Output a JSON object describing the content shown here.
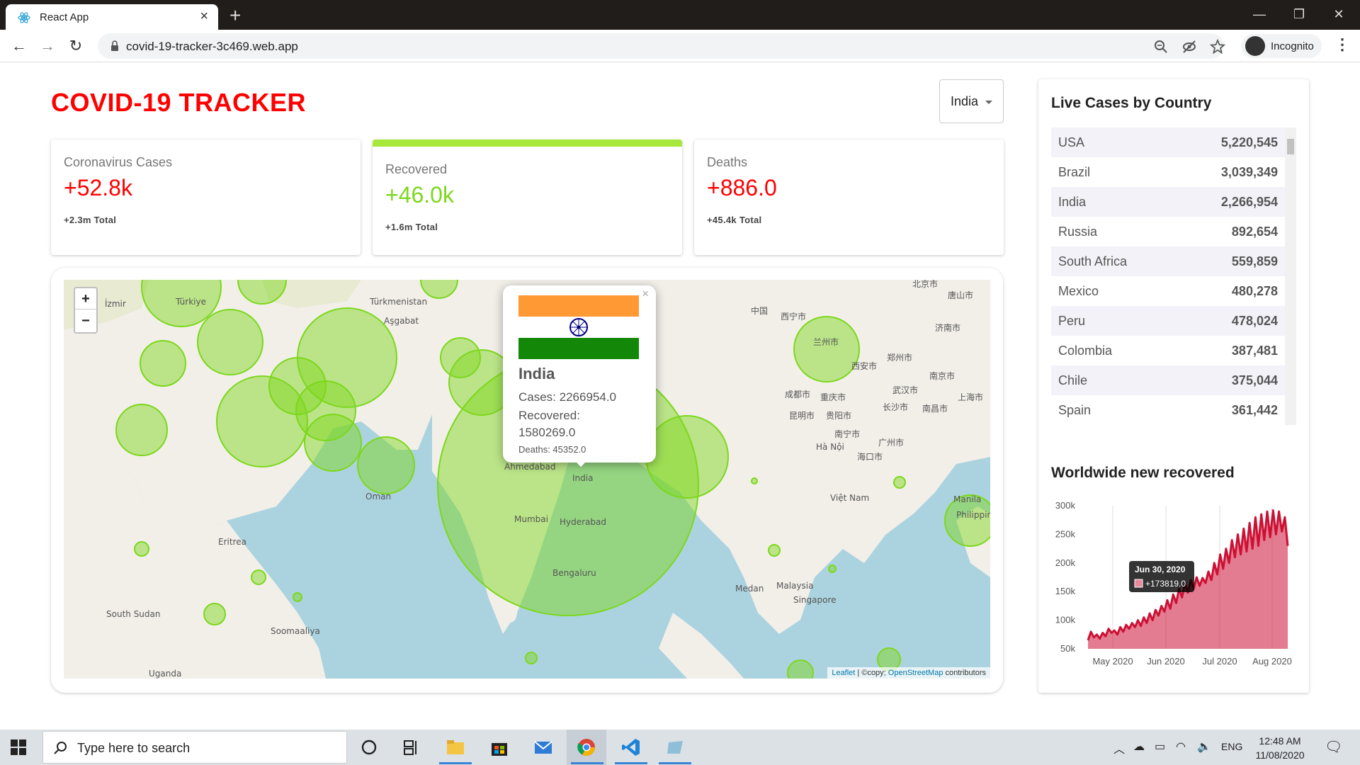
{
  "browser": {
    "tab_title": "React App",
    "url": "covid-19-tracker-3c469.web.app",
    "incognito_label": "Incognito"
  },
  "app": {
    "title": "COVID-19 TRACKER",
    "country_selected": "India"
  },
  "cards": {
    "cases": {
      "title": "Coronavirus Cases",
      "value": "+52.8k",
      "total": "+2.3m Total",
      "color": "#ff0000"
    },
    "recovered": {
      "title": "Recovered",
      "value": "+46.0k",
      "total": "+1.6m Total",
      "color": "#7dd71d"
    },
    "deaths": {
      "title": "Deaths",
      "value": "+886.0",
      "total": "+45.4k Total",
      "color": "#ff0000"
    }
  },
  "map": {
    "attribution_leaflet": "Leaflet",
    "attribution_copy": "| ©copy;",
    "attribution_osm": "OpenStreetMap",
    "attribution_contrib": "contributors",
    "popup": {
      "country": "India",
      "cases": "Cases: 2266954.0",
      "recovered_label": "Recovered:",
      "recovered_value": "1580269.0",
      "deaths": "Deaths: 45352.0"
    },
    "labels": [
      "Türkiye",
      "Türkmenistan",
      "Aşgabat",
      "India",
      "Ahmedabad",
      "Mumbai",
      "Hyderabad",
      "Bengaluru",
      "Eritrea",
      "South Sudan",
      "Soomaaliya",
      "Uganda",
      "中国",
      "西宁市",
      "兰州市",
      "西安市",
      "郑州市",
      "北京市",
      "唐山市",
      "济南市",
      "南京市",
      "上海市",
      "武汉市",
      "长沙市",
      "南昌市",
      "成都市",
      "重庆市",
      "贵阳市",
      "昆明市",
      "南宁市",
      "广州市",
      "海口市",
      "Hà Nội",
      "Việt Nam",
      "Manila",
      "Philippines",
      "Medan",
      "Malaysia",
      "Singapore",
      "İzmir",
      "Oman"
    ]
  },
  "live": {
    "heading": "Live Cases by Country",
    "rows": [
      {
        "country": "USA",
        "cases": "5,220,545"
      },
      {
        "country": "Brazil",
        "cases": "3,039,349"
      },
      {
        "country": "India",
        "cases": "2,266,954"
      },
      {
        "country": "Russia",
        "cases": "892,654"
      },
      {
        "country": "South Africa",
        "cases": "559,859"
      },
      {
        "country": "Mexico",
        "cases": "480,278"
      },
      {
        "country": "Peru",
        "cases": "478,024"
      },
      {
        "country": "Colombia",
        "cases": "387,481"
      },
      {
        "country": "Chile",
        "cases": "375,044"
      },
      {
        "country": "Spain",
        "cases": "361,442"
      }
    ]
  },
  "chart_heading": "Worldwide new recovered",
  "chart_data": {
    "type": "area",
    "x_tick_labels": [
      "May 2020",
      "Jun 2020",
      "Jul 2020",
      "Aug 2020"
    ],
    "y_tick_labels": [
      "300k",
      "250k",
      "200k",
      "150k",
      "100k",
      "50k"
    ],
    "ylim": [
      50000,
      300000
    ],
    "color": "#cc1034",
    "fill": "rgba(204,16,52,0.55)",
    "tooltip": {
      "date": "Jun 30, 2020",
      "value": "+173819.0"
    },
    "values": [
      65000,
      80000,
      70000,
      75000,
      68000,
      78000,
      72000,
      85000,
      78000,
      82000,
      75000,
      88000,
      80000,
      92000,
      85000,
      95000,
      88000,
      100000,
      90000,
      105000,
      95000,
      112000,
      100000,
      118000,
      108000,
      125000,
      115000,
      135000,
      120000,
      145000,
      130000,
      155000,
      140000,
      165000,
      148000,
      170000,
      155000,
      175000,
      160000,
      173819,
      165000,
      185000,
      170000,
      200000,
      180000,
      215000,
      190000,
      225000,
      200000,
      240000,
      210000,
      250000,
      215000,
      260000,
      220000,
      270000,
      225000,
      280000,
      230000,
      285000,
      240000,
      290000,
      245000,
      292000,
      250000,
      290000,
      255000,
      280000,
      230000
    ]
  },
  "taskbar": {
    "search_placeholder": "Type here to search",
    "lang": "ENG",
    "time": "12:48 AM",
    "date": "11/08/2020"
  }
}
